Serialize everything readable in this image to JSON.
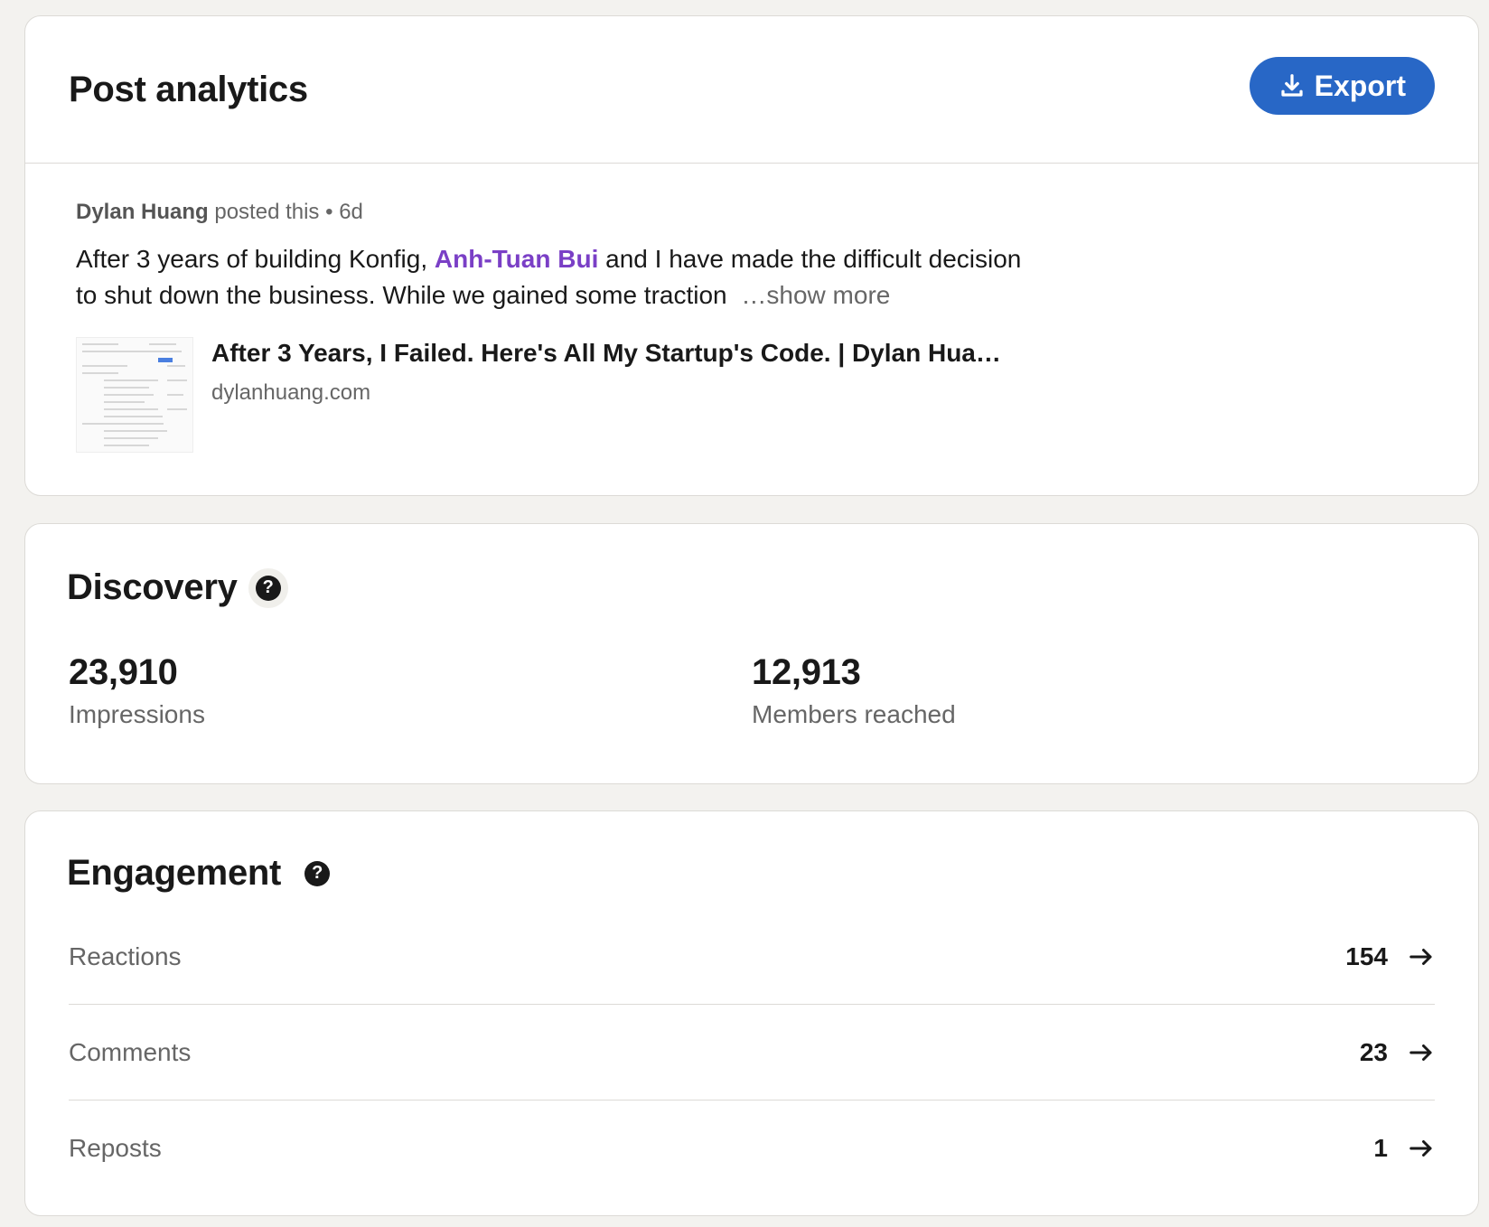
{
  "header": {
    "title": "Post analytics",
    "export_label": "Export",
    "export_icon": "download-icon",
    "accent_color": "#2867c6"
  },
  "post": {
    "author": "Dylan Huang",
    "action": "posted this",
    "separator": "•",
    "age": "6d",
    "text_before": "After 3 years of building Konfig,",
    "mention": "Anh-Tuan Bui",
    "text_after": "and I have made the difficult decision to shut down the business. While we gained some traction",
    "show_more": "…show more",
    "mention_color": "#7a3fc6",
    "link": {
      "title": "After 3 Years, I Failed. Here's All My Startup's Code. | Dylan Hua…",
      "domain": "dylanhuang.com"
    }
  },
  "discovery": {
    "title": "Discovery",
    "help_icon": "help-icon",
    "metrics": [
      {
        "value": "23,910",
        "label": "Impressions"
      },
      {
        "value": "12,913",
        "label": "Members reached"
      }
    ]
  },
  "engagement": {
    "title": "Engagement",
    "help_icon": "help-icon",
    "rows": [
      {
        "label": "Reactions",
        "value": "154",
        "icon": "arrow-right-icon"
      },
      {
        "label": "Comments",
        "value": "23",
        "icon": "arrow-right-icon"
      },
      {
        "label": "Reposts",
        "value": "1",
        "icon": "arrow-right-icon"
      }
    ]
  }
}
